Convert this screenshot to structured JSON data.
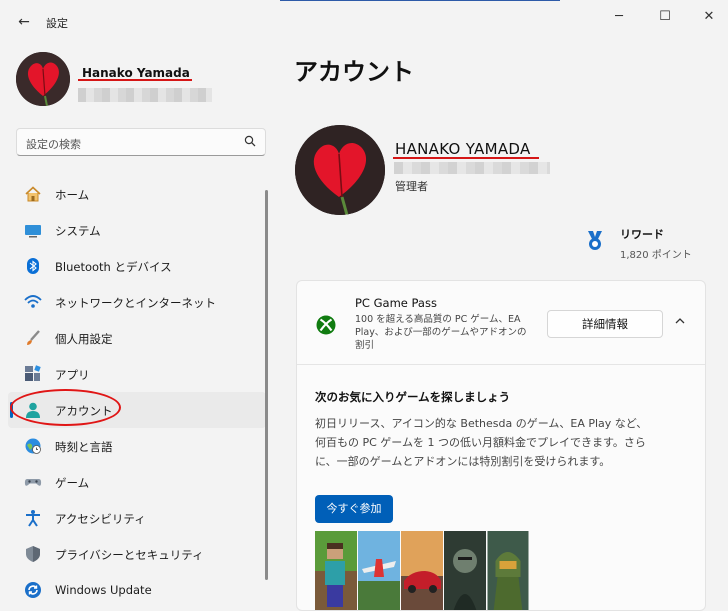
{
  "window": {
    "back_glyph": "←",
    "title": "設定",
    "minimize_glyph": "─",
    "maximize_glyph": "☐",
    "close_glyph": "✕"
  },
  "profile": {
    "name": "Hanako Yamada"
  },
  "search": {
    "placeholder": "設定の検索",
    "icon": "search-icon"
  },
  "nav": {
    "items": [
      {
        "label": "ホーム",
        "icon": "home-icon"
      },
      {
        "label": "システム",
        "icon": "system-icon"
      },
      {
        "label": "Bluetooth とデバイス",
        "icon": "bluetooth-icon"
      },
      {
        "label": "ネットワークとインターネット",
        "icon": "wifi-icon"
      },
      {
        "label": "個人用設定",
        "icon": "brush-icon"
      },
      {
        "label": "アプリ",
        "icon": "apps-icon"
      },
      {
        "label": "アカウント",
        "icon": "account-icon",
        "active": true
      },
      {
        "label": "時刻と言語",
        "icon": "globe-icon"
      },
      {
        "label": "ゲーム",
        "icon": "gamepad-icon"
      },
      {
        "label": "アクセシビリティ",
        "icon": "accessibility-icon"
      },
      {
        "label": "プライバシーとセキュリティ",
        "icon": "shield-icon"
      },
      {
        "label": "Windows Update",
        "icon": "update-icon"
      }
    ]
  },
  "main": {
    "page_title": "アカウント",
    "account": {
      "name": "HANAKO YAMADA",
      "role": "管理者"
    },
    "rewards": {
      "title": "リワード",
      "points": "1,820 ポイント"
    },
    "game_pass": {
      "title": "PC Game Pass",
      "description": "100 を超える高品質の PC ゲーム、EA Play、および一部のゲームやアドオンの割引",
      "details_button": "詳細情報",
      "promo_title": "次のお気に入りゲームを探しましょう",
      "promo_body": "初日リリース、アイコン的な Bethesda のゲーム、EA Play など、何百もの PC ゲームを 1 つの低い月額料金でプレイできます。さらに、一部のゲームとアドオンには特別割引を受けられます。",
      "join_button": "今すぐ参加"
    }
  },
  "colors": {
    "accent": "#005fb8",
    "annotation_red": "#e01616",
    "xbox_green": "#107c10"
  }
}
